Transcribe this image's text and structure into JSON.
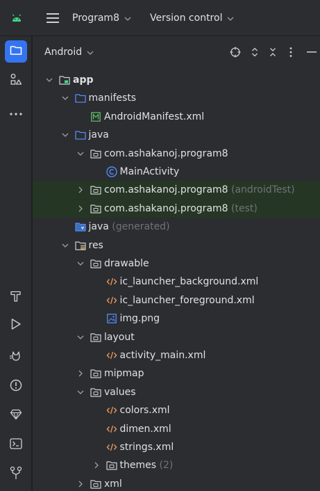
{
  "titlebar": {
    "project_name": "Program8",
    "vcs_label": "Version control"
  },
  "panel": {
    "title": "Android"
  },
  "tree": [
    {
      "label": "app",
      "icon": "module-folder-icon",
      "level": 0,
      "chevron": "down",
      "bold": true
    },
    {
      "label": "manifests",
      "icon": "folder-icon",
      "level": 1,
      "chevron": "down"
    },
    {
      "label": "AndroidManifest.xml",
      "icon": "manifest-file-icon",
      "level": 2
    },
    {
      "label": "java",
      "icon": "folder-icon",
      "level": 1,
      "chevron": "down"
    },
    {
      "label": "com.ashakanoj.program8",
      "icon": "package-icon",
      "level": 2,
      "chevron": "down"
    },
    {
      "label": "MainActivity",
      "icon": "class-icon",
      "level": 3
    },
    {
      "label": "com.ashakanoj.program8",
      "suffix": "(androidTest)",
      "icon": "package-icon",
      "level": 2,
      "chevron": "right",
      "highlight": true
    },
    {
      "label": "com.ashakanoj.program8",
      "suffix": "(test)",
      "icon": "package-icon",
      "level": 2,
      "chevron": "right",
      "highlight": true
    },
    {
      "label": "java",
      "suffix": "(generated)",
      "icon": "generated-folder-icon",
      "level": 1
    },
    {
      "label": "res",
      "icon": "res-folder-icon",
      "level": 1,
      "chevron": "down"
    },
    {
      "label": "drawable",
      "icon": "package-icon",
      "level": 2,
      "chevron": "down"
    },
    {
      "label": "ic_launcher_background.xml",
      "icon": "xml-file-icon",
      "level": 3
    },
    {
      "label": "ic_launcher_foreground.xml",
      "icon": "xml-file-icon",
      "level": 3
    },
    {
      "label": "img.png",
      "icon": "image-file-icon",
      "level": 3
    },
    {
      "label": "layout",
      "icon": "package-icon",
      "level": 2,
      "chevron": "down"
    },
    {
      "label": "activity_main.xml",
      "icon": "xml-file-icon",
      "level": 3
    },
    {
      "label": "mipmap",
      "icon": "package-icon",
      "level": 2,
      "chevron": "right"
    },
    {
      "label": "values",
      "icon": "package-icon",
      "level": 2,
      "chevron": "down"
    },
    {
      "label": "colors.xml",
      "icon": "xml-file-icon",
      "level": 3
    },
    {
      "label": "dimen.xml",
      "icon": "xml-file-icon",
      "level": 3
    },
    {
      "label": "strings.xml",
      "icon": "xml-file-icon",
      "level": 3
    },
    {
      "label": "themes",
      "suffix": "(2)",
      "icon": "package-icon",
      "level": 3,
      "chevron": "right"
    },
    {
      "label": "xml",
      "icon": "package-icon",
      "level": 2,
      "chevron": "right"
    }
  ],
  "colors": {
    "accent": "#3574f0",
    "test_highlight": "#263624",
    "xml_icon": "#e0925b",
    "manifest_icon": "#5fb865",
    "class_icon": "#548af7"
  }
}
